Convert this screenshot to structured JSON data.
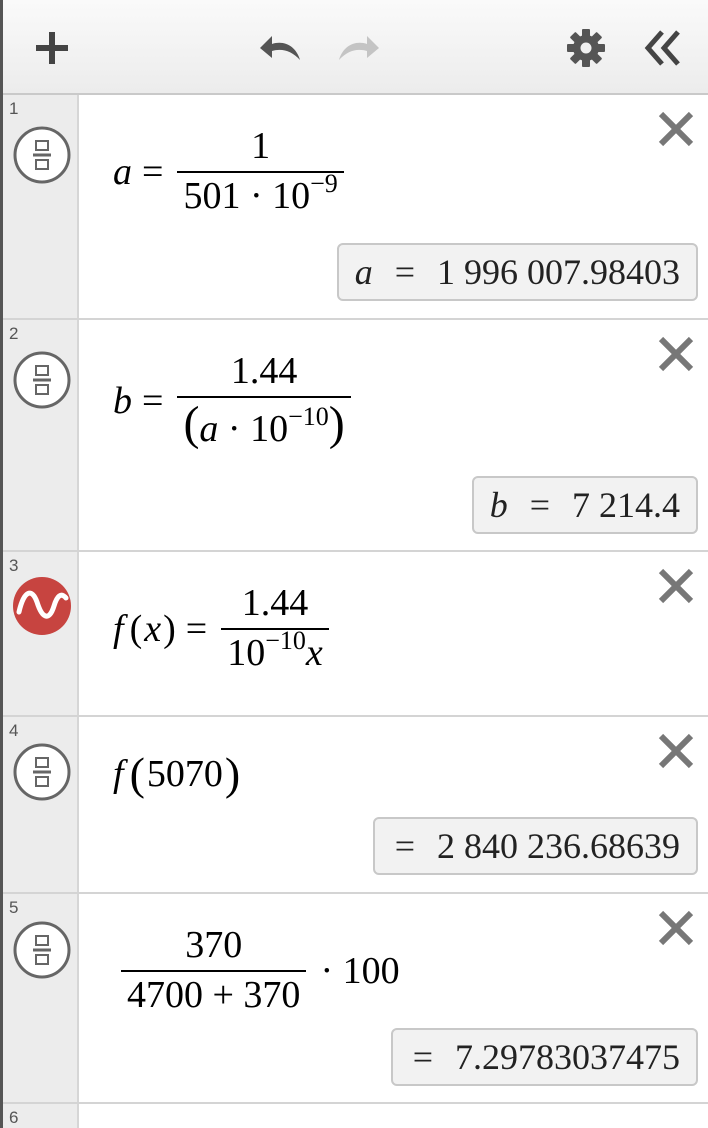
{
  "toolbar": {
    "add": "add-icon",
    "undo": "undo-icon",
    "redo": "redo-icon",
    "settings": "gear-icon",
    "collapse": "double-chevron-left-icon"
  },
  "expressions": [
    {
      "index": "1",
      "icon": "fraction-toggle-icon",
      "lhs": "a",
      "eq": "=",
      "numerator": "1",
      "den_base": "501 · 10",
      "den_exp": "−9",
      "result_var": "a",
      "result_eq": "=",
      "result_value": "1 996 007.98403"
    },
    {
      "index": "2",
      "icon": "fraction-toggle-icon",
      "lhs": "b",
      "eq": "=",
      "numerator": "1.44",
      "den_open": "(",
      "den_var": "a",
      "den_mid": " · 10",
      "den_exp": "−10",
      "den_close": ")",
      "result_var": "b",
      "result_eq": "=",
      "result_value": "7 214.4"
    },
    {
      "index": "3",
      "icon": "graph-wave-icon",
      "icon_color": "#c74440",
      "fname": "f",
      "open": "(",
      "arg": "x",
      "close": ")",
      "eq": "=",
      "numerator": "1.44",
      "den_base": "10",
      "den_exp": "−10",
      "den_var": "x"
    },
    {
      "index": "4",
      "icon": "fraction-toggle-icon",
      "fname": "f",
      "open": "(",
      "arg": "5070",
      "close": ")",
      "result_eq": "=",
      "result_value": "2 840 236.68639"
    },
    {
      "index": "5",
      "icon": "fraction-toggle-icon",
      "numerator": "370",
      "denominator": "4700 + 370",
      "tail": "· 100",
      "result_eq": "=",
      "result_value": "7.29783037475"
    },
    {
      "index": "6"
    }
  ]
}
